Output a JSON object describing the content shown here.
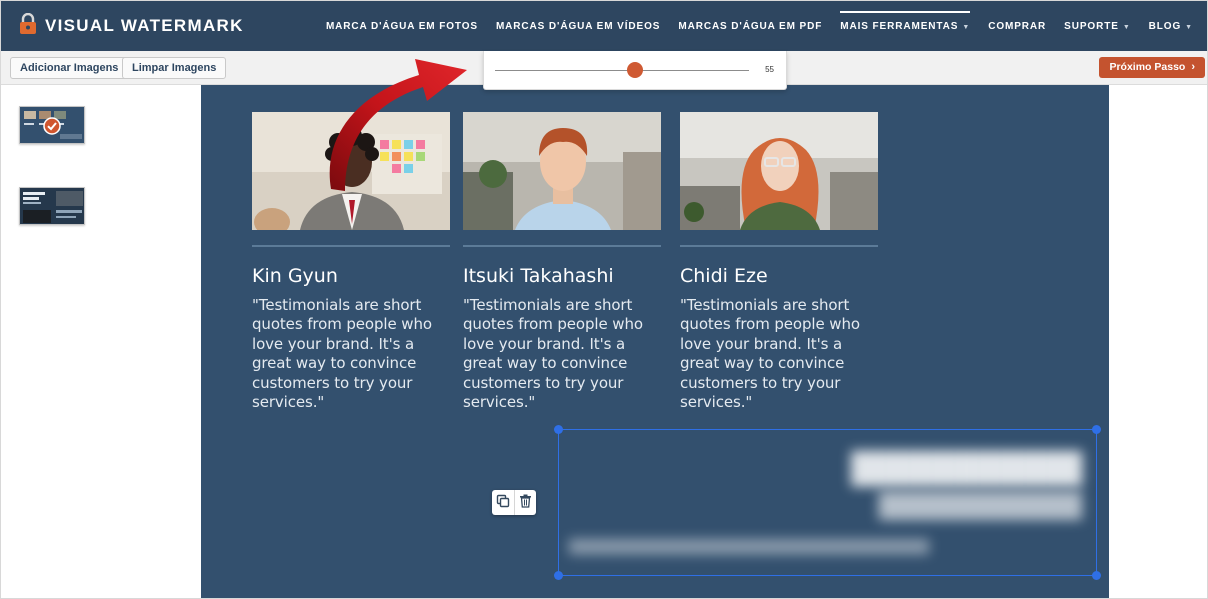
{
  "header": {
    "brand": "VISUAL WATERMARK",
    "nav": [
      {
        "label": "MARCA D'ÁGUA EM FOTOS",
        "caret": ""
      },
      {
        "label": "MARCAS D'ÁGUA EM VÍDEOS",
        "caret": ""
      },
      {
        "label": "MARCAS D'ÁGUA EM PDF",
        "caret": ""
      },
      {
        "label": "MAIS FERRAMENTAS",
        "caret": "▼"
      },
      {
        "label": "COMPRAR",
        "caret": ""
      },
      {
        "label": "SUPORTE",
        "caret": "▼"
      },
      {
        "label": "BLOG",
        "caret": "▼"
      }
    ]
  },
  "toolbar": {
    "add_images": "Adicionar Imagens",
    "clear_images": "Limpar Imagens",
    "next_step": "Próximo Passo"
  },
  "slider": {
    "value": "55",
    "fraction": 0.55
  },
  "sidebar": {
    "thumbnails": [
      {
        "selected": true
      },
      {
        "selected": false
      }
    ]
  },
  "canvas": {
    "cards": [
      {
        "name": "Kin Gyun",
        "quote": "\"Testimonials are short quotes from people who love your brand. It's a great way to convince customers to try your services.\""
      },
      {
        "name": "Itsuki Takahashi",
        "quote": "\"Testimonials are short quotes from people who love your brand. It's a great way to convince customers to try your services.\""
      },
      {
        "name": "Chidi Eze",
        "quote": "\"Testimonials are short quotes from people who love your brand. It's a great way to convince customers to try your services.\""
      }
    ]
  },
  "colors": {
    "header_bg": "#2e4660",
    "canvas_bg": "#33506e",
    "accent": "#c4532f",
    "selection": "#2f6fe6",
    "arrow": "#c4141a"
  },
  "icons": {
    "brand": "lock-icon",
    "duplicate": "duplicate-icon",
    "delete": "trash-icon",
    "next": "chevron-right-icon"
  }
}
